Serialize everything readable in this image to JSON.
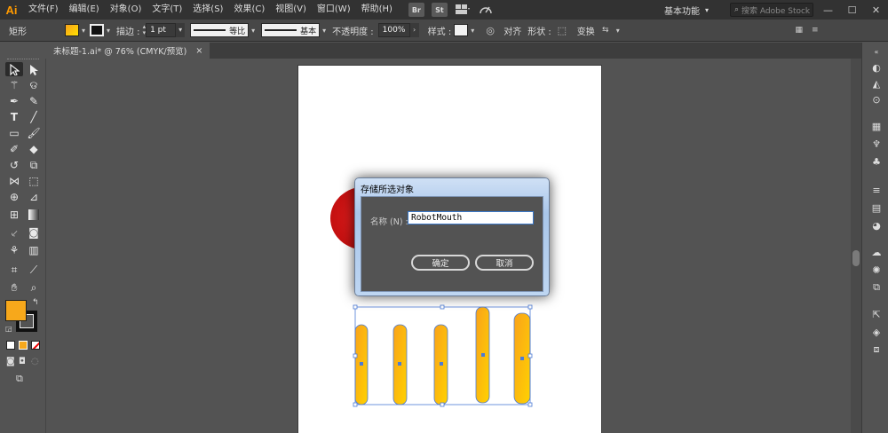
{
  "app": {
    "logo": "Ai"
  },
  "menu": [
    "文件(F)",
    "编辑(E)",
    "对象(O)",
    "文字(T)",
    "选择(S)",
    "效果(C)",
    "视图(V)",
    "窗口(W)",
    "帮助(H)"
  ],
  "menu_buttons": {
    "bridge": "Br",
    "stock": "St"
  },
  "workspace": {
    "label": "基本功能"
  },
  "search": {
    "placeholder": "搜索 Adobe Stock"
  },
  "control_bar": {
    "shape_label": "矩形",
    "stroke_label": "描边 :",
    "stroke_weight": "1 pt",
    "profile_label": "等比",
    "brush_label": "基本",
    "opacity_label": "不透明度 :",
    "opacity_value": "100%",
    "style_label": "样式 :",
    "align_label": "对齐",
    "shape_menu_label": "形状 :",
    "transform_label": "变换"
  },
  "document_tab": {
    "title": "未标题-1.ai* @ 76% (CMYK/预览)",
    "close": "×"
  },
  "dialog": {
    "title": "存储所选对象",
    "name_label": "名称 (N) :",
    "name_value": "RobotMouth",
    "ok_label": "确定",
    "cancel_label": "取消"
  },
  "colors": {
    "fill": "#f7b21c",
    "fill_gradient_top": "#f9a21b",
    "fill_gradient_bottom": "#ffd200",
    "circle": "#d81c1c",
    "selection": "#4c7bd6",
    "accent": "#ff9a00"
  },
  "icons": {
    "selection": "selection-arrow-icon",
    "direct_selection": "direct-selection-icon",
    "magic_wand": "magic-wand-icon",
    "lasso": "lasso-icon",
    "pen": "pen-icon",
    "curvature": "curvature-icon",
    "type": "type-icon",
    "line": "line-icon",
    "rectangle": "rectangle-icon",
    "paintbrush": "paintbrush-icon",
    "shaper": "shaper-icon",
    "eraser": "eraser-icon",
    "rotate": "rotate-icon",
    "scale": "scale-icon",
    "width": "width-icon",
    "free_transform": "free-transform-icon",
    "shape_builder": "shape-builder-icon",
    "perspective": "perspective-icon",
    "mesh": "mesh-icon",
    "gradient": "gradient-icon",
    "eyedropper": "eyedropper-icon",
    "blend": "blend-icon",
    "symbol_sprayer": "symbol-sprayer-icon",
    "column_graph": "column-graph-icon",
    "artboard": "artboard-icon",
    "slice": "slice-icon",
    "hand": "hand-icon",
    "zoom": "zoom-icon"
  }
}
